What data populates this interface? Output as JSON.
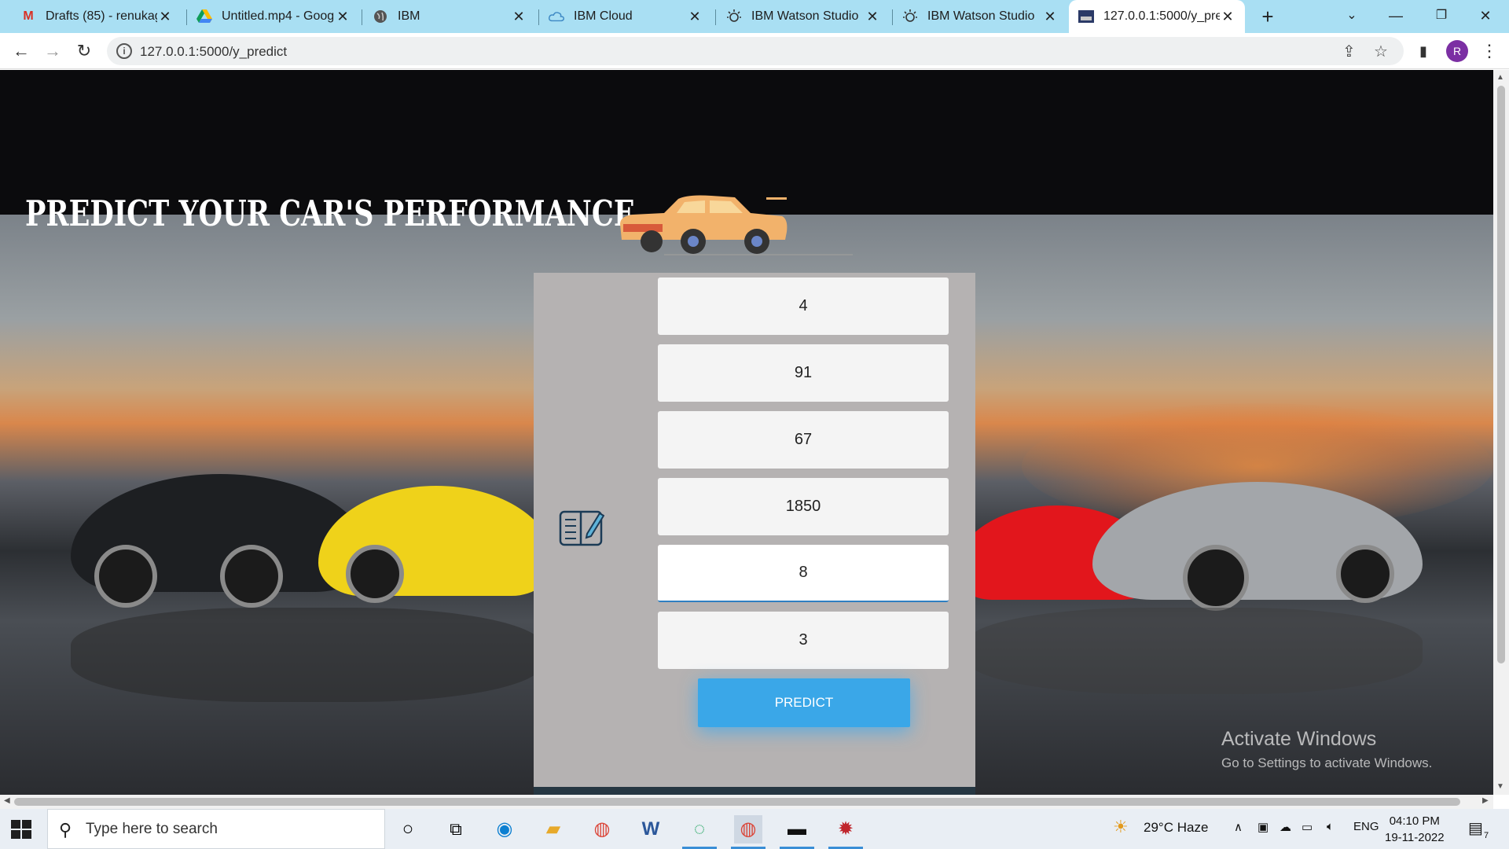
{
  "browser": {
    "tabs": [
      {
        "label": "Drafts (85) - renukaga",
        "icon": "gmail-icon"
      },
      {
        "label": "Untitled.mp4 - Googl",
        "icon": "google-drive-icon"
      },
      {
        "label": "IBM",
        "icon": "globe-icon"
      },
      {
        "label": "IBM Cloud",
        "icon": "cloud-icon"
      },
      {
        "label": "IBM Watson Studio",
        "icon": "watson-icon"
      },
      {
        "label": "IBM Watson Studio",
        "icon": "watson-icon"
      },
      {
        "label": "127.0.0.1:5000/y_pred",
        "icon": "page-favicon",
        "active": true
      }
    ],
    "address": "127.0.0.1:5000/y_predict",
    "profile_initial": "R"
  },
  "page": {
    "title": "PREDICT YOUR CAR'S PERFORMANCE",
    "fields": [
      {
        "value": "4"
      },
      {
        "value": "91"
      },
      {
        "value": "67"
      },
      {
        "value": "1850"
      },
      {
        "value": "8",
        "focused": true
      },
      {
        "value": "3"
      }
    ],
    "predict_label": "PREDICT"
  },
  "watermark": {
    "line1": "Activate Windows",
    "line2": "Go to Settings to activate Windows."
  },
  "taskbar": {
    "search_placeholder": "Type here to search",
    "weather": "29°C  Haze",
    "language": "ENG",
    "time": "04:10 PM",
    "date": "19-11-2022",
    "notification_count": "7"
  },
  "colors": {
    "tabstrip": "#a9dff3",
    "predict_button": "#3aa7e8",
    "form_panel": "#b5b2b2"
  }
}
